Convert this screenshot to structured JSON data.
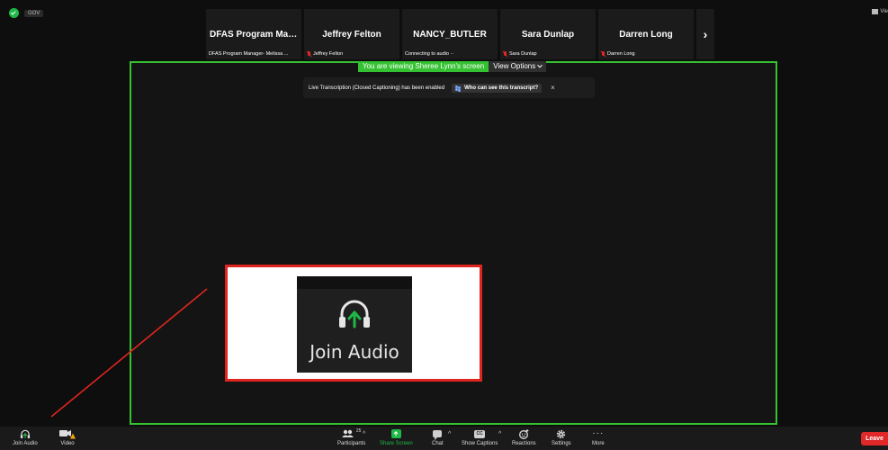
{
  "badge": {
    "label": "GOV"
  },
  "view_button": {
    "label": "Vie"
  },
  "participants_strip": [
    {
      "name": "DFAS Program Manage...",
      "sub": "DFAS Program Manager- Melissa ...",
      "muted": false
    },
    {
      "name": "Jeffrey Felton",
      "sub": "Jeffrey Felton",
      "muted": true
    },
    {
      "name": "NANCY_BUTLER",
      "sub": "Connecting to audio ··",
      "muted": false
    },
    {
      "name": "Sara Dunlap",
      "sub": "Sara Dunlap",
      "muted": true
    },
    {
      "name": "Darren Long",
      "sub": "Darren Long",
      "muted": true
    }
  ],
  "strip_next": "›",
  "share": {
    "viewing_text": "You are viewing Sheree Lynn's screen",
    "view_options": "View Options"
  },
  "caption_toast": {
    "message": "Live Transcription (Closed Captioning) has been enabled",
    "who_button": "Who can see this transcript?",
    "close": "×"
  },
  "callout": {
    "label": "Join Audio"
  },
  "toolbar": {
    "join_audio": "Join Audio",
    "video": "Video",
    "participants": "Participants",
    "participants_count": "25",
    "share_screen": "Share Screen",
    "chat": "Chat",
    "show_captions": "Show Captions",
    "reactions": "Reactions",
    "settings": "Settings",
    "more": "More",
    "leave": "Leave"
  },
  "colors": {
    "accent_green": "#35c232",
    "alert_red": "#e0251f",
    "background": "#0e0e0e"
  },
  "icons": [
    "shield-icon",
    "headset-icon",
    "camera-icon",
    "warning-icon",
    "participants-icon",
    "share-screen-icon",
    "chat-icon",
    "cc-icon",
    "reactions-icon",
    "gear-icon",
    "more-icon",
    "mic-muted-icon",
    "chevron-right-icon",
    "chevron-down-icon",
    "close-icon"
  ]
}
